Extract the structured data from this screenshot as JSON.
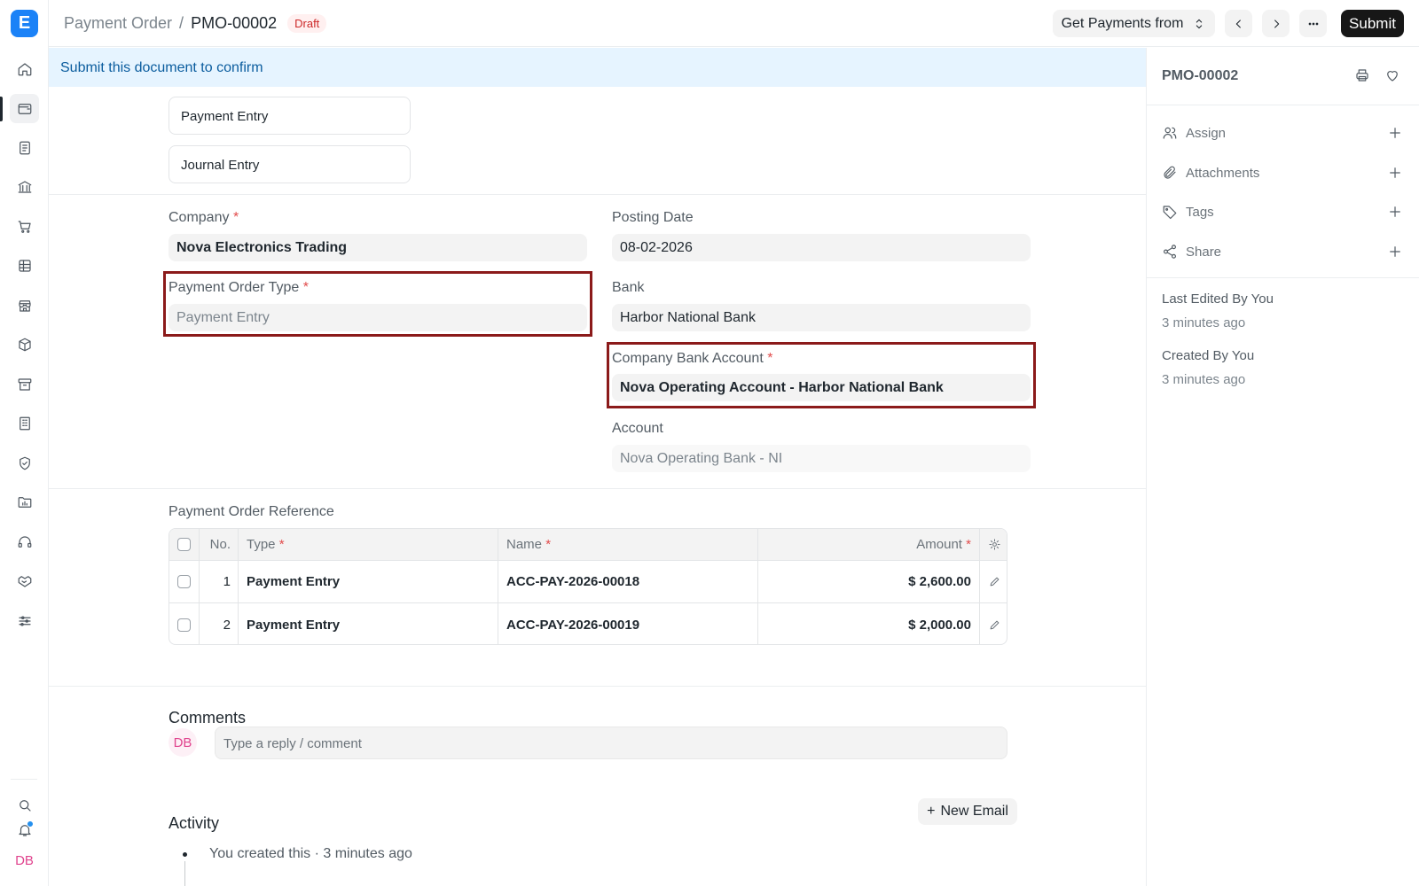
{
  "app": {
    "logo_letter": "E",
    "accent": "#1b82f7",
    "user_initials": "DB"
  },
  "rail": {
    "items": [
      "home-icon",
      "wallet-icon",
      "file-text-icon",
      "bank-icon",
      "cart-icon",
      "table-icon",
      "store-icon",
      "package-icon",
      "archive-icon",
      "building-icon",
      "shield-icon",
      "folder-chart-icon",
      "headset-icon",
      "handshake-icon",
      "sliders-icon"
    ],
    "bottom": [
      "search-icon",
      "bell-icon"
    ]
  },
  "topbar": {
    "breadcrumb_parent": "Payment Order",
    "separator": "/",
    "doc_name": "PMO-00002",
    "status": "Draft",
    "get_payments_label": "Get Payments from",
    "submit_label": "Submit"
  },
  "banner": {
    "text": "Submit this document to confirm"
  },
  "links": {
    "payment_entry": "Payment Entry",
    "journal_entry": "Journal Entry"
  },
  "form": {
    "company_label": "Company",
    "company_value": "Nova Electronics Trading",
    "posting_date_label": "Posting Date",
    "posting_date_value": "08-02-2026",
    "payment_order_type_label": "Payment Order Type",
    "payment_order_type_value": "Payment Entry",
    "bank_label": "Bank",
    "bank_value": "Harbor National Bank",
    "company_bank_account_label": "Company Bank Account",
    "company_bank_account_value": "Nova Operating Account - Harbor National Bank",
    "account_label": "Account",
    "account_value": "Nova Operating Bank - NI",
    "required_mark": "*"
  },
  "reference_table": {
    "title": "Payment Order Reference",
    "columns": {
      "no": "No.",
      "type": "Type",
      "name": "Name",
      "amount": "Amount"
    },
    "rows": [
      {
        "no": "1",
        "type": "Payment Entry",
        "name": "ACC-PAY-2026-00018",
        "amount": "$ 2,600.00"
      },
      {
        "no": "2",
        "type": "Payment Entry",
        "name": "ACC-PAY-2026-00019",
        "amount": "$ 2,000.00"
      }
    ]
  },
  "comments": {
    "title": "Comments",
    "avatar": "DB",
    "placeholder": "Type a reply / comment"
  },
  "activity": {
    "title": "Activity",
    "new_email_label": "New Email",
    "items": [
      "You created this · 3 minutes ago"
    ]
  },
  "sidebar": {
    "title": "PMO-00002",
    "assign": "Assign",
    "attachments": "Attachments",
    "tags": "Tags",
    "share": "Share",
    "last_edited_label": "Last Edited By You",
    "last_edited_time": "3 minutes ago",
    "created_label": "Created By You",
    "created_time": "3 minutes ago"
  }
}
